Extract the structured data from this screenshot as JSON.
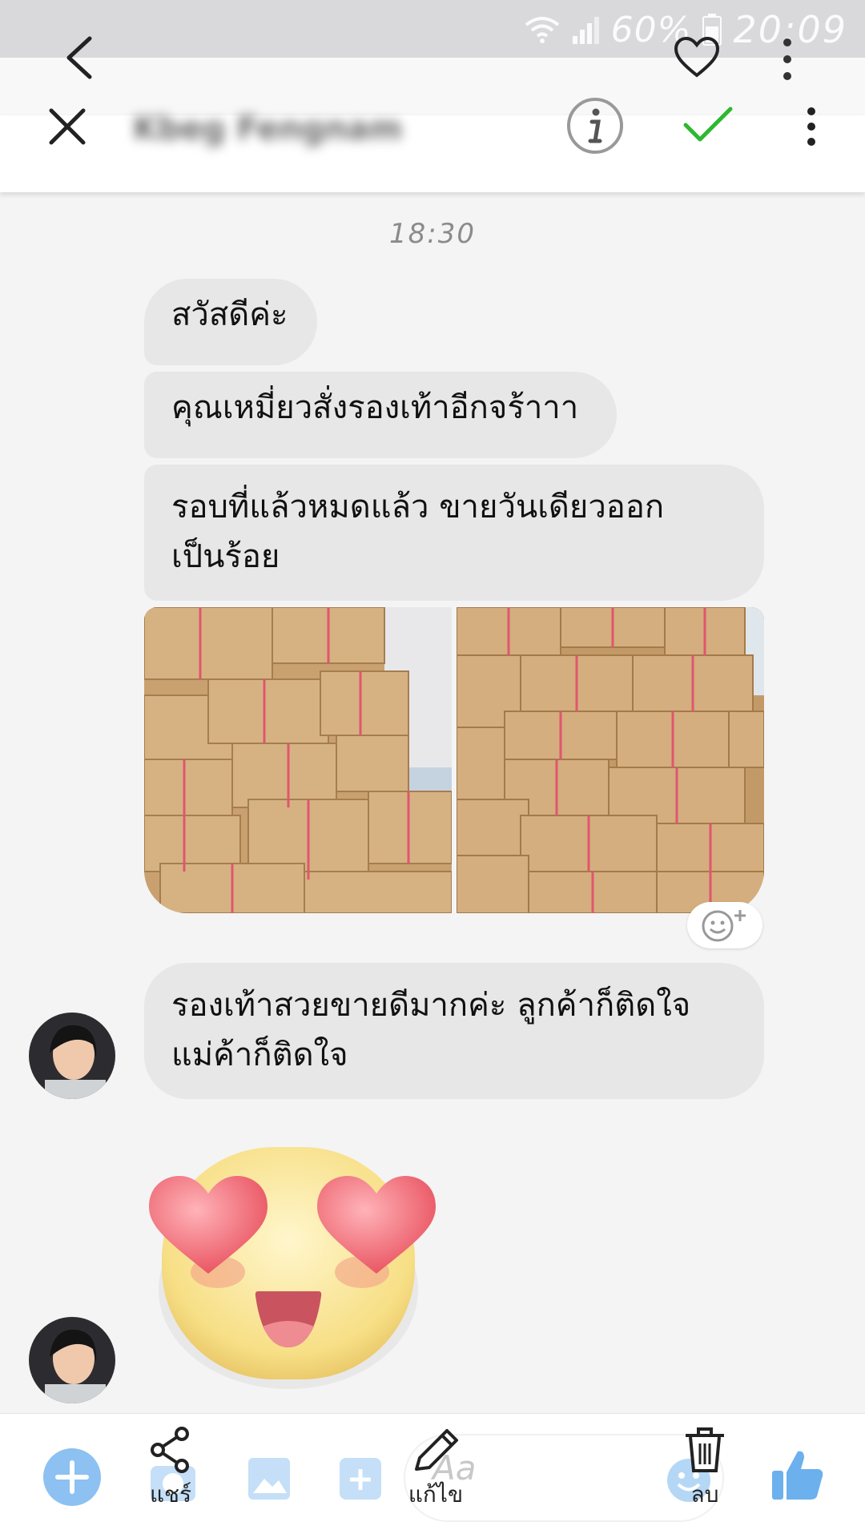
{
  "status_bar": {
    "battery_text": "60%",
    "time": "20:09"
  },
  "chat": {
    "contact_name": "Kbeg Fengnam",
    "timestamp": "18:30",
    "messages": [
      {
        "type": "text",
        "lines": [
          "สวัสดีค่ะ"
        ]
      },
      {
        "type": "text",
        "lines": [
          "คุณเหมี่ยวสั่งรองเท้าอีกจร้าาา"
        ]
      },
      {
        "type": "text",
        "lines": [
          "รอบที่แล้วหมดแล้ว ขายวันเดียวออก",
          "เป็นร้อย"
        ]
      },
      {
        "type": "photos",
        "count": 2
      },
      {
        "type": "text",
        "lines": [
          "รองเท้าสวยขายดีมากค่ะ ลูกค้าก็ติดใจ",
          "แม่ค้าก็ติดใจ"
        ]
      },
      {
        "type": "sticker",
        "name": "heart-eyes-sticker"
      }
    ]
  },
  "bottom_bar": {
    "share_label": "แชร์",
    "edit_label": "แก้ไข",
    "delete_label": "ลบ",
    "compose_placeholder": "Aa"
  },
  "icons": {
    "back": "back-arrow-icon",
    "heart": "heart-outline-icon",
    "more": "more-vert-icon",
    "close": "close-icon",
    "info": "info-icon",
    "check": "check-icon",
    "share": "share-icon",
    "edit": "pencil-icon",
    "delete": "trash-icon",
    "like": "thumbs-up-icon"
  },
  "colors": {
    "accent_blue": "#2f8fe6",
    "check_green": "#2db82d",
    "bubble_gray": "#e7e7e8"
  }
}
